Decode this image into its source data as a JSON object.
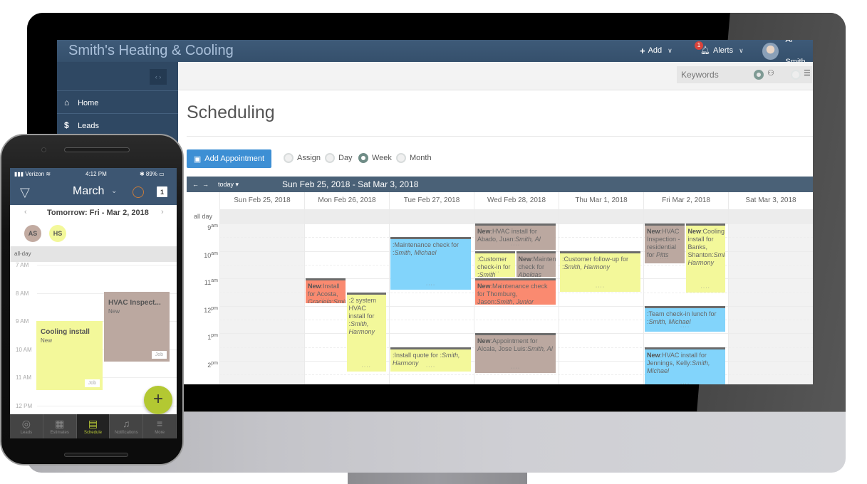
{
  "desktop": {
    "app_title": "Smith's Heating & Cooling",
    "nav": {
      "add_label": "Add",
      "alerts_label": "Alerts",
      "alerts_count": "1",
      "user_name": "Al Smith"
    },
    "sidebar": {
      "toggle_label": "‹ ›",
      "items": [
        {
          "label": "Home",
          "icon": "⌂"
        },
        {
          "label": "Leads",
          "icon": "$"
        }
      ]
    },
    "search": {
      "placeholder": "Keywords",
      "people_icon": "⚇",
      "list_icon": "☰"
    },
    "page_title": "Scheduling",
    "toolbar": {
      "add_appointment_label": "Add Appointment",
      "views": [
        {
          "label": "Assign",
          "selected": false
        },
        {
          "label": "Day",
          "selected": false
        },
        {
          "label": "Week",
          "selected": true
        },
        {
          "label": "Month",
          "selected": false
        }
      ]
    },
    "calendar": {
      "prev": "←",
      "next": "→",
      "today_label": "today ▾",
      "range": "Sun Feb 25, 2018 - Sat Mar 3, 2018",
      "all_day_label": "all day",
      "days": [
        "Sun Feb 25, 2018",
        "Mon Feb 26, 2018",
        "Tue Feb 27, 2018",
        "Wed Feb 28, 2018",
        "Thu Mar 1, 2018",
        "Fri Mar 2, 2018",
        "Sat Mar 3, 2018"
      ],
      "hours": [
        {
          "h": "9",
          "ap": "am"
        },
        {
          "h": "10",
          "ap": "am"
        },
        {
          "h": "11",
          "ap": "am"
        },
        {
          "h": "12",
          "ap": "pm"
        },
        {
          "h": "1",
          "ap": "pm"
        },
        {
          "h": "2",
          "ap": "pm"
        }
      ],
      "events": [
        {
          "day": 1,
          "start": 11.0,
          "end": 11.9,
          "lane": 0,
          "lanes": 2,
          "color": "red",
          "prefix": "New",
          "text": ":Install for Acosta, ",
          "who": "Graciela:Smith"
        },
        {
          "day": 1,
          "start": 11.5,
          "end": 14.4,
          "lane": 1,
          "lanes": 2,
          "color": "yellow",
          "prefix": "",
          "text": ":2 system HVAC install for :",
          "who": "Smith, Harmony"
        },
        {
          "day": 2,
          "start": 9.5,
          "end": 11.4,
          "lane": 0,
          "lanes": 1,
          "color": "blue",
          "prefix": "",
          "text": ":Maintenance check for :",
          "who": "Smith, Michael"
        },
        {
          "day": 2,
          "start": 13.5,
          "end": 14.4,
          "lane": 0,
          "lanes": 1,
          "color": "yellow",
          "prefix": "",
          "text": ":Install quote for :",
          "who": "Smith, Harmony"
        },
        {
          "day": 3,
          "start": 9.0,
          "end": 9.95,
          "lane": 0,
          "lanes": 1,
          "color": "brown",
          "prefix": "New",
          "text": ":HVAC install for Abado, Juan:",
          "who": "Smith, Al"
        },
        {
          "day": 3,
          "start": 10.0,
          "end": 10.95,
          "lane": 0,
          "lanes": 2,
          "color": "yellow",
          "prefix": "",
          "text": ":Customer check-in for :",
          "who": "Smith"
        },
        {
          "day": 3,
          "start": 10.0,
          "end": 10.95,
          "lane": 1,
          "lanes": 2,
          "color": "brown",
          "prefix": "New",
          "text": ":Maintenance check for ",
          "who": "Abelgas"
        },
        {
          "day": 3,
          "start": 11.0,
          "end": 11.95,
          "lane": 0,
          "lanes": 1,
          "color": "red",
          "prefix": "New",
          "text": ":Maintenance check for Thomburg, Jason:",
          "who": "Smith, Junior"
        },
        {
          "day": 3,
          "start": 13.0,
          "end": 14.45,
          "lane": 0,
          "lanes": 1,
          "color": "brown",
          "prefix": "New",
          "text": ":Appointment for Alcala, Jose Luis:",
          "who": "Smith, Al"
        },
        {
          "day": 4,
          "start": 10.0,
          "end": 11.5,
          "lane": 0,
          "lanes": 1,
          "color": "yellow",
          "prefix": "",
          "text": ":Customer follow-up for :",
          "who": "Smith, Harmony"
        },
        {
          "day": 5,
          "start": 9.0,
          "end": 10.45,
          "lane": 0,
          "lanes": 2,
          "color": "brown",
          "prefix": "New",
          "text": ":HVAC Inspection - residential for ",
          "who": "Pitts"
        },
        {
          "day": 5,
          "start": 9.0,
          "end": 11.5,
          "lane": 1,
          "lanes": 2,
          "color": "yellow",
          "prefix": "New",
          "text": ":Cooling install for Banks, Shanton:",
          "who": "Smith, Harmony"
        },
        {
          "day": 5,
          "start": 12.0,
          "end": 12.95,
          "lane": 0,
          "lanes": 1,
          "color": "blue",
          "prefix": "",
          "text": ":Team check-in lunch for :",
          "who": "Smith, Michael"
        },
        {
          "day": 5,
          "start": 13.5,
          "end": 15.0,
          "lane": 0,
          "lanes": 1,
          "color": "blue",
          "prefix": "New",
          "text": ":HVAC install for Jennings, Kelly:",
          "who": "Smith, Michael"
        }
      ]
    }
  },
  "phone": {
    "status": {
      "carrier": "▮▮▮ Verizon ≋",
      "time": "4:12 PM",
      "battery": "✱ 89% ▭"
    },
    "header": {
      "month": "March",
      "chevron": "⌄",
      "calendar_day": "1"
    },
    "date_nav": {
      "prev": "‹",
      "label": "Tomorrow: Fri - Mar 2, 2018",
      "next": "›"
    },
    "techs": [
      "AS",
      "HS"
    ],
    "all_day_label": "all-day",
    "hours": [
      "7 AM",
      "8 AM",
      "9 AM",
      "10 AM",
      "11 AM",
      "12 PM"
    ],
    "events": [
      {
        "title": "HVAC Inspect...",
        "status": "New",
        "tag": "Job",
        "color": "brown"
      },
      {
        "title": "Cooling install",
        "status": "New",
        "tag": "Job",
        "color": "yellow"
      }
    ],
    "fab_label": "+",
    "tabs": [
      {
        "label": "Leads",
        "icon": "◎",
        "active": false
      },
      {
        "label": "Estimates",
        "icon": "▦",
        "active": false
      },
      {
        "label": "Schedule",
        "icon": "▤",
        "active": true
      },
      {
        "label": "Notifications",
        "icon": "♫",
        "active": false
      },
      {
        "label": "More",
        "icon": "≡",
        "active": false
      }
    ]
  },
  "colors": {
    "nav_bg": "#3e5a78",
    "sidebar_bg": "#2f4863",
    "accent_button": "#3d8fd4",
    "event_blue": "#82d4fb",
    "event_yellow": "#f3f89a",
    "event_brown": "#bba8a0",
    "event_red": "#fa8a70",
    "phone_accent": "#b3c832"
  }
}
